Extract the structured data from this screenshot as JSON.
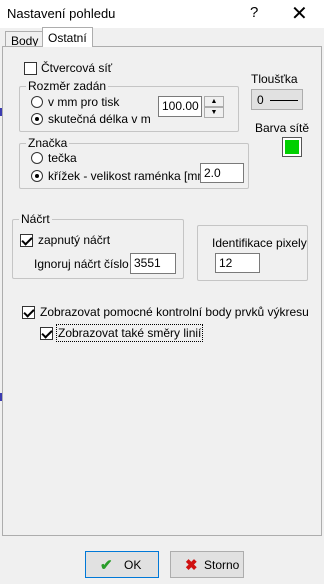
{
  "window": {
    "title": "Nastavení pohledu",
    "help": "?",
    "close": "✕"
  },
  "tabs": [
    {
      "label": "Body"
    },
    {
      "label": "Ostatní"
    }
  ],
  "grid": {
    "checkbox_label": "Čtvercová síť",
    "size_group": "Rozměr zadán",
    "option_print": "v mm pro tisk",
    "option_real": "skutečná délka v m",
    "size_value": "100.00",
    "thickness_label": "Tloušťka",
    "thickness_value": "0",
    "color_label": "Barva sítě",
    "color": "#00d000"
  },
  "mark": {
    "group": "Značka",
    "option_dot": "tečka",
    "option_cross": "křížek - velikost raménka [mm]",
    "cross_value": "2.0"
  },
  "sketch": {
    "group": "Náčrt",
    "enabled_label": "zapnutý náčrt",
    "ignore_label": "Ignoruj náčrt číslo",
    "ignore_value": "3551"
  },
  "pixel_id": {
    "label": "Identifikace pixely",
    "value": "12"
  },
  "options": {
    "show_control_points": "Zobrazovat pomocné kontrolní body prvků výkresu",
    "show_line_directions": "Zobrazovat také směry linií"
  },
  "buttons": {
    "ok": "OK",
    "cancel": "Storno"
  },
  "colors": {
    "ok_icon": "#2a9d2a",
    "cancel_icon": "#d01010"
  }
}
